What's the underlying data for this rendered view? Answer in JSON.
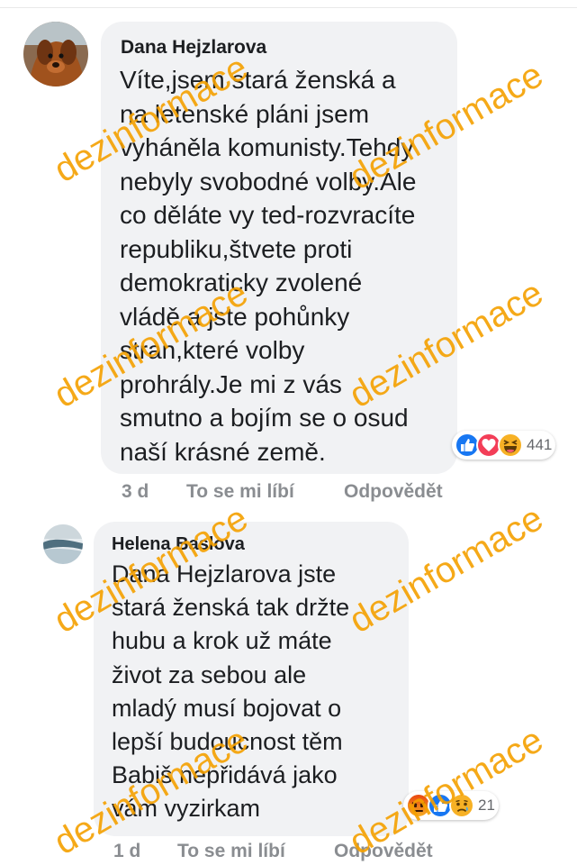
{
  "comments": [
    {
      "author": "Dana Hejzlarova",
      "text": "Víte,jsem stará ženská a\nna letenské pláni jsem\nvyháněla komunisty.Tehdy\nnebyly svobodné volby.Ale\nco děláte vy ted-rozvracíte\nrepubliku,štvete proti\ndemokraticky zvolené\nvládě a jste pohůnky\nstran,které volby\nprohrály.Je mi z vás\nsmutno a bojím se o osud\nnaší krásné země.",
      "reaction_icons": [
        "like-icon",
        "love-icon",
        "haha-icon"
      ],
      "reaction_count": "441",
      "time": "3 d",
      "like_label": "To se mi líbí",
      "reply_label": "Odpovědět"
    },
    {
      "author": "Helena Baslova",
      "text": "Dana Hejzlarova jste\nstará ženská tak držte\nhubu a krok už máte\nživot za sebou ale\nmladý musí bojovat o\nlepší budoucnost těm\nBabiš nepřidává jako\nvám vyzirkam",
      "reaction_icons": [
        "angry-icon",
        "like-icon",
        "sad-icon"
      ],
      "reaction_count": "21",
      "time": "1 d",
      "like_label": "To se mi líbí",
      "reply_label": "Odpovědět"
    }
  ],
  "watermark": "dezinformace",
  "colors": {
    "bubble": "#f1f2f4",
    "text": "#1c1e21",
    "meta": "#8a8d91",
    "watermark": "#f5a000",
    "like": "#1877f2",
    "love": "#f33e58",
    "haha": "#f7b125",
    "angry": "#e9710f"
  }
}
